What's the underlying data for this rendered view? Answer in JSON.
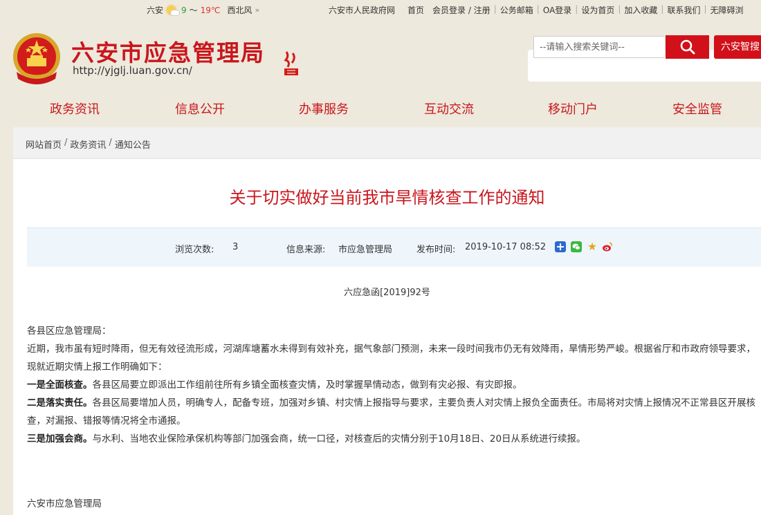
{
  "topbar": {
    "city": "六安",
    "temp_low": "9",
    "temp_sep": "～",
    "temp_high": "19℃",
    "wind": "西北风",
    "more": "»",
    "links": [
      "六安市人民政府网",
      "首页",
      "会员登录 / 注册",
      "公务邮箱",
      "OA登录",
      "设为首页",
      "加入收藏",
      "联系我们",
      "无障碍浏"
    ]
  },
  "header": {
    "title": "六安市应急管理局",
    "url": "http://yjglj.luan.gov.cn/",
    "search_placeholder": "--请输入搜索关键词--",
    "smart_search": "六安智搜"
  },
  "nav": [
    "政务资讯",
    "信息公开",
    "办事服务",
    "互动交流",
    "移动门户",
    "安全监管"
  ],
  "breadcrumb": [
    "网站首页",
    "政务资讯",
    "通知公告"
  ],
  "article": {
    "title": "关于切实做好当前我市旱情核查工作的通知",
    "views_label": "浏览次数:",
    "views": "3",
    "source_label": "信息来源:",
    "source": "市应急管理局",
    "date_label": "发布时间:",
    "date": "2019-10-17 08:52",
    "doc_no": "六应急函[2019]92号",
    "salutation": "各县区应急管理局：",
    "intro": "近期，我市虽有短时降雨，但无有效径流形成，河湖库塘蓄水未得到有效补充，据气象部门预测，未来一段时间我市仍无有效降雨，旱情形势严峻。根据省厅和市政府领导要求，现就近期灾情上报工作明确如下：",
    "p1_bold": "一是全面核查。",
    "p1": "各县区局要立即派出工作组前往所有乡镇全面核查灾情，及时掌握旱情动态，做到有灾必报、有灾即报。",
    "p2_bold": "二是落实责任。",
    "p2": "各县区局要增加人员，明确专人，配备专班，加强对乡镇、村灾情上报指导与要求，主要负责人对灾情上报负全面责任。市局将对灾情上报情况不正常县区开展核查，对漏报、错报等情况将全市通报。",
    "p3_bold": "三是加强会商。",
    "p3": "与水利、当地农业保险承保机构等部门加强会商，统一口径，对核查后的灾情分别于10月18日、20日从系统进行续报。",
    "signature": "六安市应急管理局"
  },
  "colors": {
    "brand_red": "#c9161d",
    "search_red": "#d2101a",
    "page_bg": "#ede9dc"
  }
}
